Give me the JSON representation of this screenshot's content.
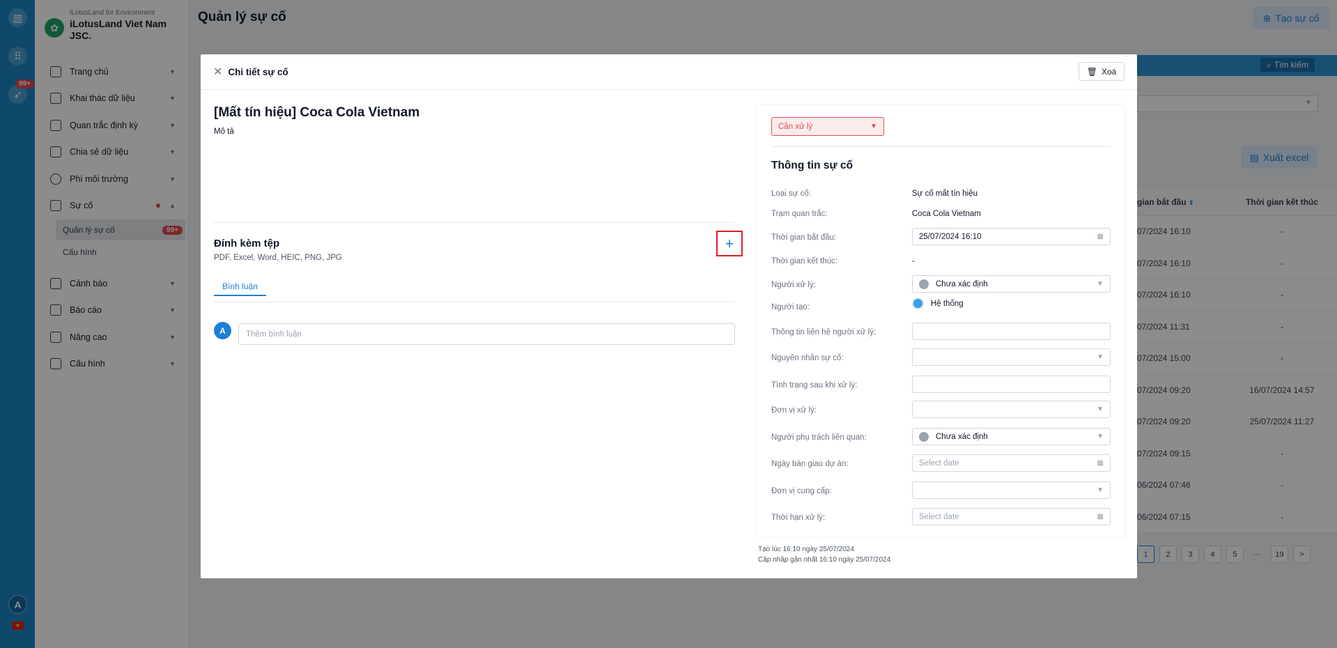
{
  "rail": {
    "badge": "99+",
    "avatar": "A",
    "icons": [
      "logo-icon",
      "apps-grid-icon",
      "rocket-icon"
    ]
  },
  "sidebar": {
    "brand_sub": "iLotusLand for Environment",
    "brand_name": "iLotusLand Viet Nam JSC.",
    "items": [
      {
        "label": "Trang chủ",
        "icon": "home-icon"
      },
      {
        "label": "Khai thác dữ liệu",
        "icon": "monitor-icon"
      },
      {
        "label": "Quan trắc định kỳ",
        "icon": "list-icon"
      },
      {
        "label": "Chia sẻ dữ liệu",
        "icon": "share-icon"
      },
      {
        "label": "Phí môi trường",
        "icon": "dollar-icon"
      },
      {
        "label": "Sự cố",
        "icon": "edit-icon"
      },
      {
        "label": "Cảnh báo",
        "icon": "alarm-icon"
      },
      {
        "label": "Báo cáo",
        "icon": "report-icon"
      },
      {
        "label": "Nâng cao",
        "icon": "megaphone-icon"
      },
      {
        "label": "Cấu hình",
        "icon": "settings-icon"
      }
    ],
    "sub_items": [
      {
        "label": "Quản lý sự cố",
        "badge": "99+"
      },
      {
        "label": "Cấu hình"
      }
    ]
  },
  "main": {
    "title": "Quản lý sự cố",
    "create_label": "Tạo sự cố",
    "search_label": "Tìm kiếm",
    "export_label": "Xuất excel",
    "columns": [
      "gian bắt đầu",
      "Thời gian kết thúc"
    ],
    "rows": [
      [
        "07/2024 16:10",
        "-"
      ],
      [
        "07/2024 16:10",
        "-"
      ],
      [
        "07/2024 16:10",
        "-"
      ],
      [
        "07/2024 11:31",
        "-"
      ],
      [
        "07/2024 15:00",
        "-"
      ],
      [
        "07/2024 09:20",
        "16/07/2024 14:57"
      ],
      [
        "07/2024 09:20",
        "25/07/2024 11:27"
      ],
      [
        "07/2024 09:15",
        "-"
      ],
      [
        "06/2024 07:46",
        "-"
      ],
      [
        "06/2024 07:15",
        "-"
      ]
    ],
    "pages": [
      "1",
      "2",
      "3",
      "4",
      "5",
      "···",
      "19",
      ">"
    ]
  },
  "modal": {
    "title": "Chi tiết sự cố",
    "delete_label": "Xoá",
    "incident_title": "[Mất tín hiệu] Coca Cola Vietnam",
    "description_label": "Mô tả",
    "attach_title": "Đính kèm tệp",
    "attach_types": "PDF, Excel, Word, HEIC, PNG, JPG",
    "add_symbol": "+",
    "tab_comment": "Bình luận",
    "comment_avatar": "A",
    "comment_placeholder": "Thêm bình luận",
    "status": "Cần xử lý",
    "info_title": "Thông tin sự cố",
    "fields": {
      "type_label": "Loại sự cố:",
      "type_value": "Sự cố mất tín hiệu",
      "station_label": "Trạm quan trắc:",
      "station_value": "Coca Cola Vietnam",
      "start_label": "Thời gian bắt đầu:",
      "start_value": "25/07/2024 16:10",
      "end_label": "Thời gian kết thúc:",
      "end_value": "-",
      "handler_label": "Người xử lý:",
      "handler_value": "Chưa xác định",
      "creator_label": "Người tạo:",
      "creator_value": "Hệ thống",
      "contact_label": "Thông tin liên hệ người xử lý:",
      "cause_label": "Nguyên nhân sự cố:",
      "after_label": "Tình trạng sau khi xử lý:",
      "unit_label": "Đơn vị xử lý:",
      "related_label": "Người phụ trách liên quan:",
      "related_value": "Chưa xác định",
      "handover_label": "Ngày bàn giao dự án:",
      "handover_placeholder": "Select date",
      "supplier_label": "Đơn vị cung cấp:",
      "deadline_label": "Thời hạn xử lý:",
      "deadline_placeholder": "Select date"
    },
    "created_note": "Tạo lúc 16:10 ngày 25/07/2024",
    "updated_note": "Cập nhập gần nhất 16:10 ngày 25/07/2024"
  }
}
